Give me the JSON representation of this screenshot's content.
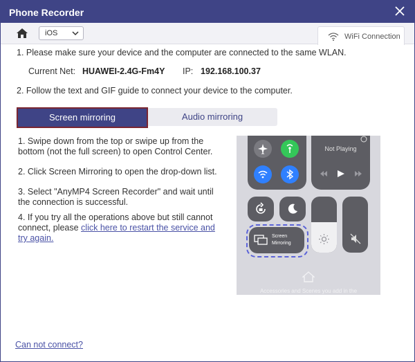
{
  "window": {
    "title": "Phone Recorder"
  },
  "toolbar": {
    "platform_select": "iOS",
    "wifi_tab": "WiFi Connection"
  },
  "step1": {
    "text": "1. Please make sure your device and the computer are connected to the same WLAN.",
    "current_net_label": "Current Net:",
    "current_net_value": "HUAWEI-2.4G-Fm4Y",
    "ip_label": "IP:",
    "ip_value": "192.168.100.37"
  },
  "step2": {
    "text": "2. Follow the text and GIF guide to connect your device to the computer."
  },
  "tabs": [
    {
      "label": "Screen mirroring"
    },
    {
      "label": "Audio mirroring"
    }
  ],
  "instructions": {
    "s1": "1. Swipe down from the top or swipe up from the bottom (not the full screen) to open Control Center.",
    "s2": "2. Click Screen Mirroring to open the drop-down list.",
    "s3": "3. Select \"AnyMP4 Screen Recorder\" and wait until the connection is successful.",
    "s4_prefix": "4. If you try all the operations above but still cannot connect, please ",
    "s4_link": "click here to restart the service and try again."
  },
  "control_center": {
    "now_playing": "Not Playing",
    "screen_mirroring_line1": "Screen",
    "screen_mirroring_line2": "Mirroring",
    "bottom_text": "Accessories and Scenes you add in the",
    "accent_blue": "#2f80ff",
    "accent_green": "#34c759",
    "tile_color": "#5d5d63"
  },
  "footer": {
    "cannot_connect": "Can not connect?"
  },
  "colors": {
    "brand": "#3f4486",
    "highlight_border": "#7b2631"
  }
}
